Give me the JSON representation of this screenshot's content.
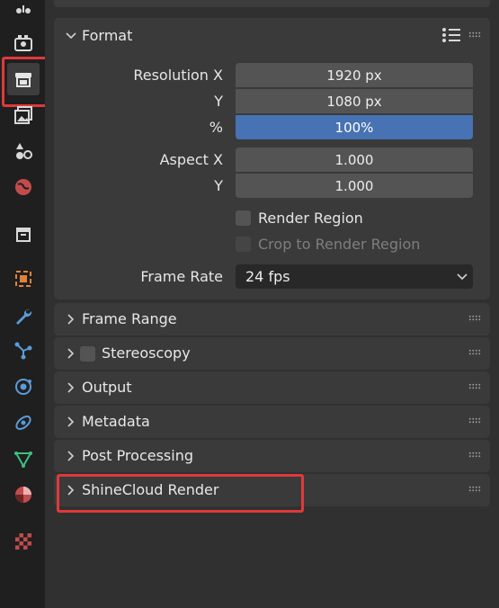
{
  "tabs": [
    {
      "name": "tool",
      "icon": "tool-icon"
    },
    {
      "name": "render",
      "icon": "camera-back-icon"
    },
    {
      "name": "output",
      "icon": "printer-icon",
      "active": true,
      "highlighted": true
    },
    {
      "name": "view-layer",
      "icon": "image-stack-icon"
    },
    {
      "name": "scene",
      "icon": "scene-shapes-icon"
    },
    {
      "name": "world",
      "icon": "world-icon"
    },
    {
      "name": "collection",
      "icon": "collection-box-icon"
    },
    {
      "name": "object",
      "icon": "object-square-icon"
    },
    {
      "name": "modifiers",
      "icon": "wrench-icon"
    },
    {
      "name": "particles",
      "icon": "particles-icon"
    },
    {
      "name": "physics",
      "icon": "physics-orbit-icon"
    },
    {
      "name": "constraints",
      "icon": "constraint-icon"
    },
    {
      "name": "data",
      "icon": "mesh-triangle-icon"
    },
    {
      "name": "material",
      "icon": "material-sphere-icon"
    },
    {
      "name": "texture",
      "icon": "checker-texture-icon"
    }
  ],
  "colors": {
    "highlight": "#e0393a",
    "accent_blue": "#4772b3"
  },
  "format": {
    "title": "Format",
    "resolution_x_label": "Resolution X",
    "resolution_x_value": "1920 px",
    "resolution_y_label": "Y",
    "resolution_y_value": "1080 px",
    "percent_label": "%",
    "percent_value": "100%",
    "aspect_x_label": "Aspect X",
    "aspect_x_value": "1.000",
    "aspect_y_label": "Y",
    "aspect_y_value": "1.000",
    "render_region_label": "Render Region",
    "crop_label": "Crop to Render Region",
    "frame_rate_label": "Frame Rate",
    "frame_rate_value": "24 fps"
  },
  "panels": {
    "frame_range": "Frame Range",
    "stereoscopy": "Stereoscopy",
    "output": "Output",
    "metadata": "Metadata",
    "post_processing": "Post Processing",
    "shinecloud": "ShineCloud Render"
  }
}
